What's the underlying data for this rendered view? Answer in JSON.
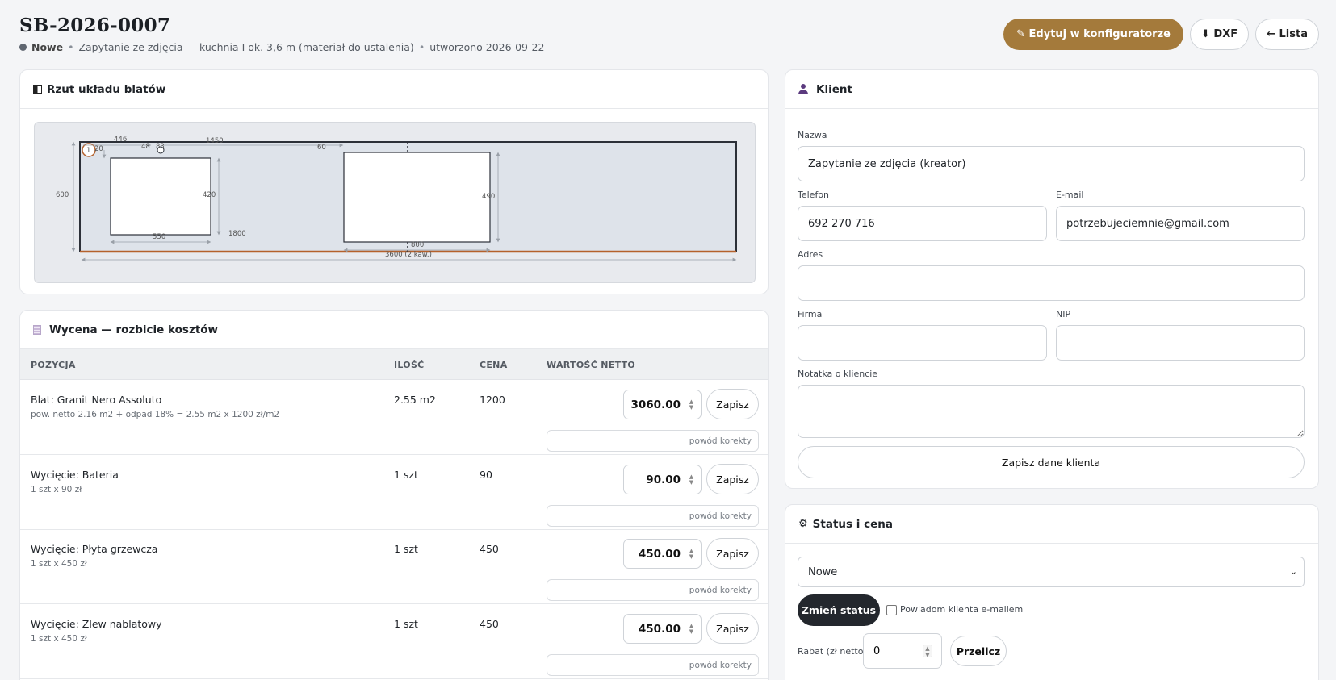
{
  "header": {
    "title": "SB-2026-0007",
    "status": "Nowe",
    "subtitle": "Zapytanie ze zdjęcia — kuchnia I ok. 3,6 m (materiał do ustalenia)",
    "created": "utworzono 2026-09-22",
    "edit_label": "✎ Edytuj w konfiguratorze",
    "dxf_label": "⬇ DXF",
    "list_label": "← Lista",
    "accent_color": "#a47a3b"
  },
  "plan": {
    "title": "Rzut układu blatów",
    "icon": "layout-icon",
    "dims": {
      "d446": "446",
      "d48": "48",
      "d83": "83",
      "d1450": "1450",
      "d60": "60",
      "d600": "600",
      "d420": "420",
      "d490": "490",
      "d550": "550",
      "d1800": "1800",
      "d800": "800",
      "total": "3600 (2 kaw.)",
      "small": "20",
      "marker": "1"
    }
  },
  "quote": {
    "title": "Wycena — rozbicie kosztów",
    "icon": "receipt-icon",
    "columns": {
      "position": "POZYCJA",
      "qty": "ILOŚĆ",
      "price": "CENA",
      "value": "WARTOŚĆ NETTO"
    },
    "save_label": "Zapisz",
    "reason_placeholder": "powód korekty",
    "rows": [
      {
        "name": "Blat: Granit Nero Assoluto",
        "desc": "pow. netto 2.16 m2 + odpad 18% = 2.55 m2 x 1200 zł/m2",
        "qty": "2.55 m2",
        "price": "1200",
        "value": "3060.00"
      },
      {
        "name": "Wycięcie: Bateria",
        "desc": "1 szt x 90 zł",
        "qty": "1 szt",
        "price": "90",
        "value": "90.00"
      },
      {
        "name": "Wycięcie: Płyta grzewcza",
        "desc": "1 szt x 450 zł",
        "qty": "1 szt",
        "price": "450",
        "value": "450.00"
      },
      {
        "name": "Wycięcie: Zlew nablatowy",
        "desc": "1 szt x 450 zł",
        "qty": "1 szt",
        "price": "450",
        "value": "450.00"
      }
    ]
  },
  "client": {
    "title": "Klient",
    "icon": "user-icon",
    "name_label": "Nazwa",
    "name_value": "Zapytanie ze zdjęcia (kreator)",
    "phone_label": "Telefon",
    "phone_value": "692 270 716",
    "email_label": "E-mail",
    "email_value": "potrzebujeciemnie@gmail.com",
    "address_label": "Adres",
    "address_value": "",
    "company_label": "Firma",
    "company_value": "",
    "nip_label": "NIP",
    "nip_value": "",
    "note_label": "Notatka o kliencie",
    "save_label": "Zapisz dane klienta"
  },
  "status": {
    "title": "Status i cena",
    "icon": "gear-icon",
    "selected": "Nowe",
    "change_label": "Zmień status",
    "notify_label": "Powiadom klienta e-mailem",
    "discount_label": "Rabat (zł netto)",
    "discount_value": "0",
    "recalc_label": "Przelicz"
  }
}
